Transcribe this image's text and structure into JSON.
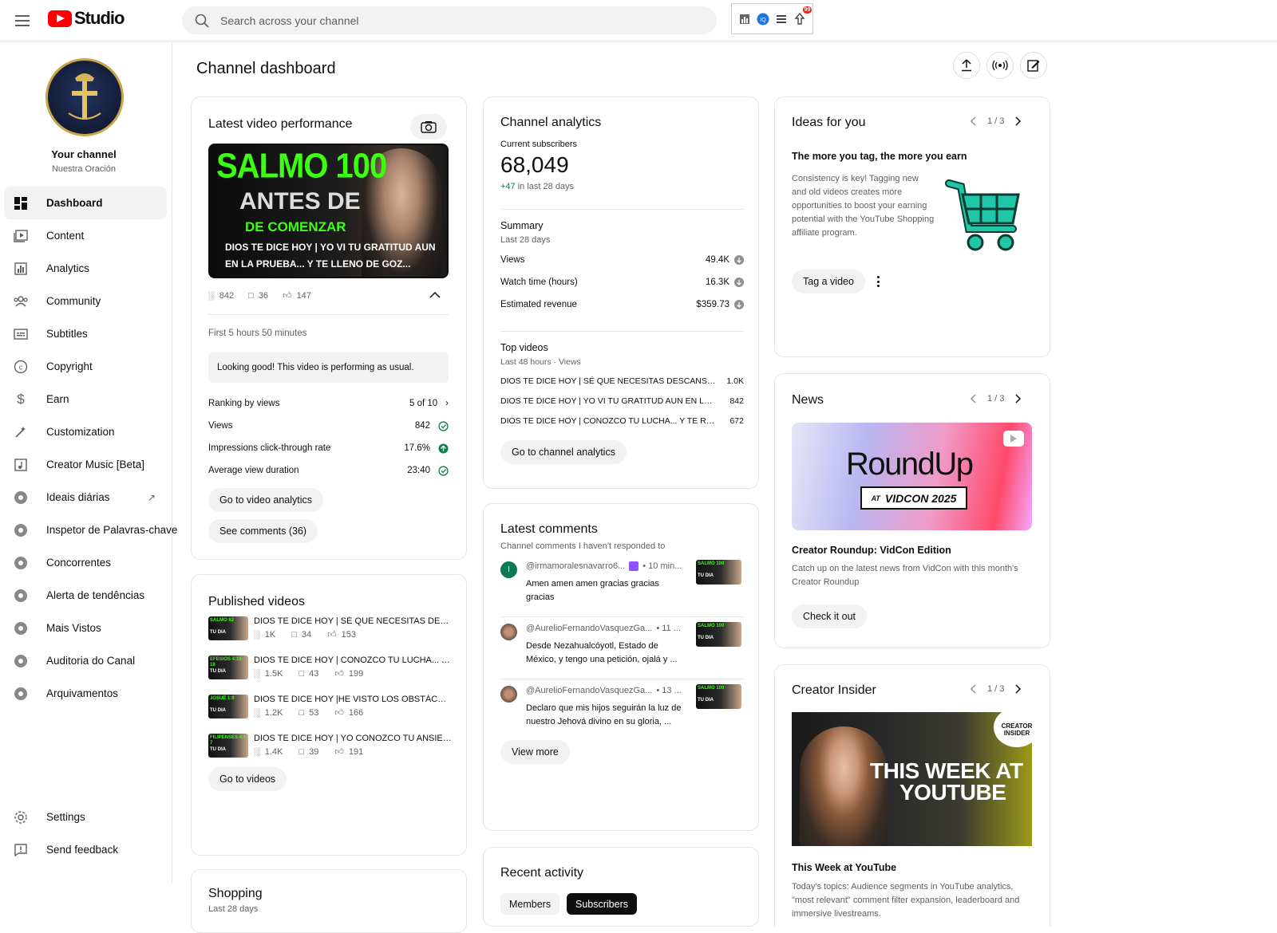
{
  "topbar": {
    "logo_text": "Studio",
    "search_placeholder": "Search across your channel",
    "ext_badge": "99"
  },
  "sidebar": {
    "channel_title": "Your channel",
    "channel_name": "Nuestra Oración",
    "items": [
      {
        "label": "Dashboard",
        "icon": "dashboard-icon"
      },
      {
        "label": "Content",
        "icon": "content-icon"
      },
      {
        "label": "Analytics",
        "icon": "analytics-icon"
      },
      {
        "label": "Community",
        "icon": "community-icon"
      },
      {
        "label": "Subtitles",
        "icon": "subtitles-icon"
      },
      {
        "label": "Copyright",
        "icon": "copyright-icon"
      },
      {
        "label": "Earn",
        "icon": "earn-icon"
      },
      {
        "label": "Customization",
        "icon": "customization-icon"
      },
      {
        "label": "Creator Music [Beta]",
        "icon": "music-icon"
      },
      {
        "label": "Ideais diárias",
        "icon": "extension-icon"
      },
      {
        "label": "Inspetor de Palavras-chave",
        "icon": "extension-icon"
      },
      {
        "label": "Concorrentes",
        "icon": "extension-icon"
      },
      {
        "label": "Alerta de tendências",
        "icon": "extension-icon"
      },
      {
        "label": "Mais Vistos",
        "icon": "extension-icon"
      },
      {
        "label": "Auditoria do Canal",
        "icon": "extension-icon"
      },
      {
        "label": "Arquivamentos",
        "icon": "extension-icon"
      }
    ],
    "settings_label": "Settings",
    "feedback_label": "Send feedback"
  },
  "page": {
    "title": "Channel dashboard"
  },
  "latest_video": {
    "title": "Latest video performance",
    "thumb_line1": "SALMO 100",
    "thumb_line2": "ANTES DE",
    "thumb_line3": "DE COMENZAR",
    "thumb_caption": "DIOS TE DICE HOY | YO VI TU GRATITUD AUN EN LA PRUEBA... Y TE LLENO DE GOZ...",
    "views": "842",
    "comments": "36",
    "likes": "147",
    "period": "First 5 hours 50 minutes",
    "status": "Looking good! This video is performing as usual.",
    "metrics": [
      {
        "label": "Ranking by views",
        "value": "5 of 10"
      },
      {
        "label": "Views",
        "value": "842"
      },
      {
        "label": "Impressions click-through rate",
        "value": "17.6%"
      },
      {
        "label": "Average view duration",
        "value": "23:40"
      }
    ],
    "btn_analytics": "Go to video analytics",
    "btn_comments": "See comments (36)"
  },
  "published": {
    "title": "Published videos",
    "videos": [
      {
        "title": "DIOS TE DICE HOY | SÉ QUE NECESITAS DESC...",
        "views": "1K",
        "comments": "34",
        "likes": "153",
        "thumb": "SALMO 62",
        "thumb2": "TU DIA"
      },
      {
        "title": "DIOS TE DICE HOY | CONOZCO TU LUCHA... Y T...",
        "views": "1.5K",
        "comments": "43",
        "likes": "199",
        "thumb": "EFESIOS 4:16-18",
        "thumb2": "TU DIA"
      },
      {
        "title": "DIOS TE DICE HOY |HE VISTO LOS OBSTÁCUL...",
        "views": "1.2K",
        "comments": "53",
        "likes": "166",
        "thumb": "JOSUÉ 1:9",
        "thumb2": "TU DIA"
      },
      {
        "title": "DIOS TE DICE HOY | YO CONOZCO TU ANSIED...",
        "views": "1.4K",
        "comments": "39",
        "likes": "191",
        "thumb": "FILIPENSES 4:6-7",
        "thumb2": "TU DIA"
      }
    ],
    "btn": "Go to videos"
  },
  "shopping": {
    "title": "Shopping",
    "sub": "Last 28 days"
  },
  "analytics": {
    "title": "Channel analytics",
    "subs_label": "Current subscribers",
    "subs_value": "68,049",
    "subs_delta": "+47",
    "subs_delta_suffix": "in last 28 days",
    "summary_title": "Summary",
    "summary_period": "Last 28 days",
    "summary": [
      {
        "label": "Views",
        "value": "49.4K"
      },
      {
        "label": "Watch time (hours)",
        "value": "16.3K"
      },
      {
        "label": "Estimated revenue",
        "value": "$359.73"
      }
    ],
    "top_title": "Top videos",
    "top_period": "Last 48 hours · Views",
    "top": [
      {
        "title": "DIOS TE DICE HOY | SÉ QUE NECESITAS DESCANSA...",
        "value": "1.0K"
      },
      {
        "title": "DIOS TE DICE HOY | YO VI TU GRATITUD AUN EN LA...",
        "value": "842"
      },
      {
        "title": "DIOS TE DICE HOY | CONOZCO TU LUCHA... Y TE RE...",
        "value": "672"
      }
    ],
    "btn": "Go to channel analytics"
  },
  "comments": {
    "title": "Latest comments",
    "sub": "Channel comments I haven't responded to",
    "items": [
      {
        "author": "@irmamoralesnavarro6...",
        "time": "• 10 min...",
        "text": "Amen amen amen  gracias gracias gracias",
        "initial": "I"
      },
      {
        "author": "@AurelioFernandoVasquezGa...",
        "time": "• 11 ...",
        "text": "Desde Nezahualcóyotl, Estado de México, y tengo una petición, ojalá y ...",
        "initial": ""
      },
      {
        "author": "@AurelioFernandoVasquezGa...",
        "time": "• 13 ...",
        "text": "Declaro que mis hijos seguirán la luz de nuestro Jehová divino en su gloria, ...",
        "initial": ""
      }
    ],
    "thumb": "SALMO 100",
    "thumb2": "TU DIA",
    "btn": "View more"
  },
  "activity": {
    "title": "Recent activity",
    "tab_members": "Members",
    "tab_subscribers": "Subscribers"
  },
  "ideas": {
    "title": "Ideas for you",
    "pager": "1 / 3",
    "headline": "The more you tag, the more you earn",
    "body": "Consistency is key! Tagging new and old videos creates more opportunities to boost your earning potential with the YouTube Shopping affiliate program.",
    "btn": "Tag a video"
  },
  "news": {
    "title": "News",
    "pager": "1 / 3",
    "banner_title": "RoundUp",
    "banner_at": "AT",
    "banner_sub": "VIDCON 2025",
    "headline": "Creator Roundup: VidCon Edition",
    "body": "Catch up on the latest news from VidCon with this month's Creator Roundup",
    "btn": "Check it out"
  },
  "insider": {
    "title": "Creator Insider",
    "pager": "1 / 3",
    "banner_badge_1": "CREATOR",
    "banner_badge_2": "INSIDER",
    "banner_text_1": "THIS WEEK AT",
    "banner_text_2": "YOUTUBE",
    "headline": "This Week at YouTube",
    "body": "Today's topics: Audience segments in YouTube analytics, \"most relevant\" comment filter expansion, leaderboard and immersive livestreams."
  },
  "colors": {
    "accent_red": "#ff0000",
    "green": "#0b8043",
    "teal": "#1fc7a8"
  }
}
